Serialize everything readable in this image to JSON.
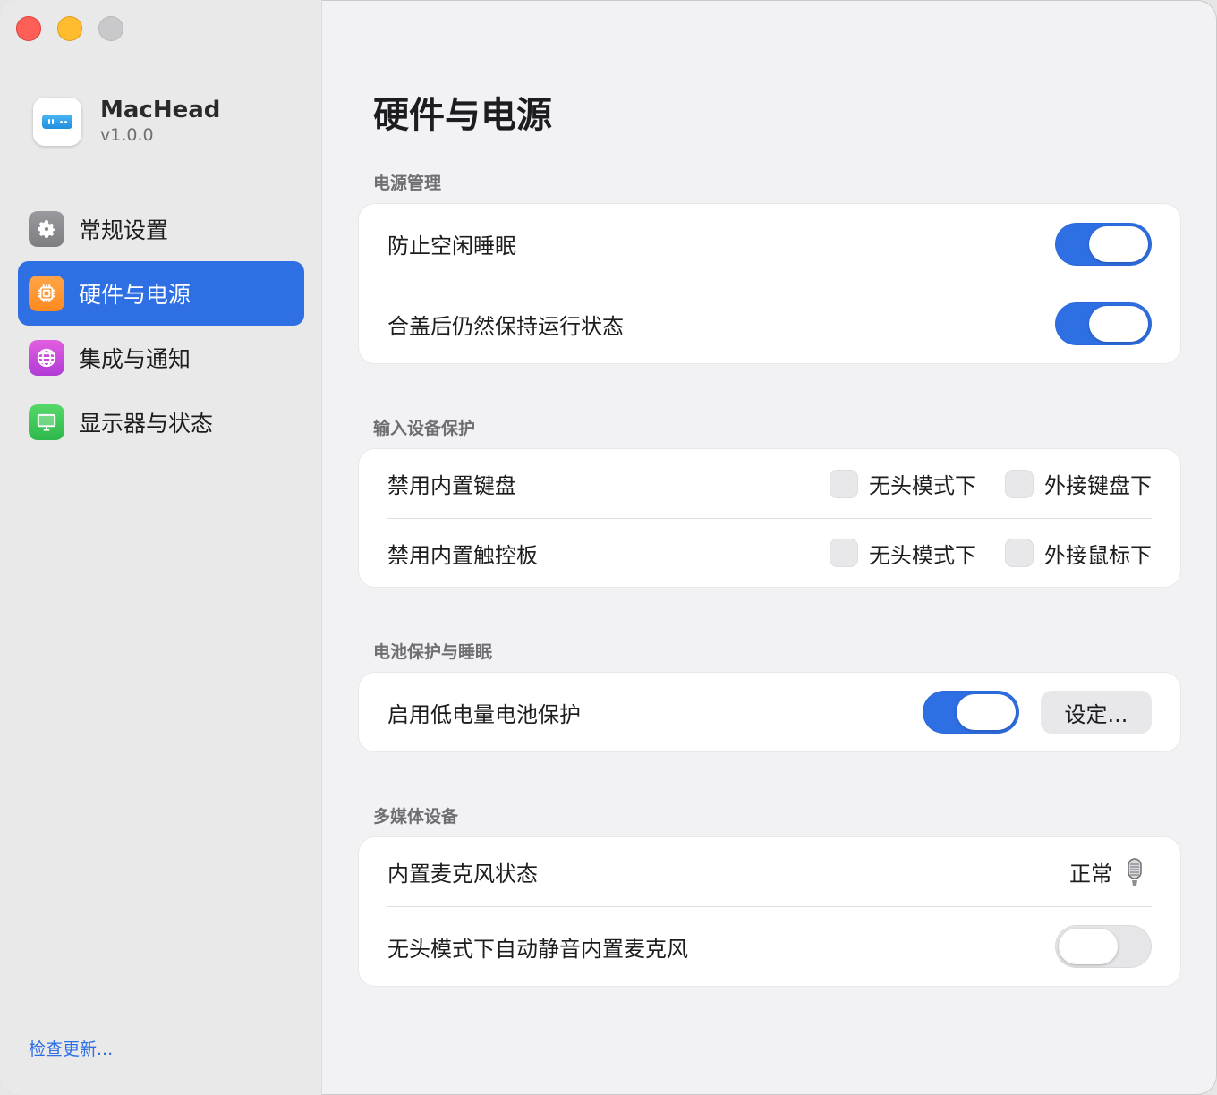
{
  "app": {
    "name": "MacHead",
    "version": "v1.0.0"
  },
  "sidebar": {
    "items": [
      {
        "label": "常规设置",
        "icon": "gear-icon"
      },
      {
        "label": "硬件与电源",
        "icon": "chip-icon"
      },
      {
        "label": "集成与通知",
        "icon": "globe-icon"
      },
      {
        "label": "显示器与状态",
        "icon": "monitor-icon"
      }
    ],
    "active_index": 1,
    "check_update": "检查更新..."
  },
  "page": {
    "title": "硬件与电源"
  },
  "sections": {
    "power": {
      "title": "电源管理",
      "rows": [
        {
          "label": "防止空闲睡眠",
          "enabled": true
        },
        {
          "label": "合盖后仍然保持运行状态",
          "enabled": true
        }
      ]
    },
    "input": {
      "title": "输入设备保护",
      "rows": [
        {
          "label": "禁用内置键盘",
          "option1": "无头模式下",
          "option2": "外接键盘下",
          "option1_checked": false,
          "option2_checked": false
        },
        {
          "label": "禁用内置触控板",
          "option1": "无头模式下",
          "option2": "外接鼠标下",
          "option1_checked": false,
          "option2_checked": false
        }
      ]
    },
    "battery": {
      "title": "电池保护与睡眠",
      "rows": [
        {
          "label": "启用低电量电池保护",
          "enabled": true,
          "button": "设定..."
        }
      ]
    },
    "media": {
      "title": "多媒体设备",
      "rows": [
        {
          "label": "内置麦克风状态",
          "status": "正常",
          "icon": "microphone-icon"
        },
        {
          "label": "无头模式下自动静音内置麦克风",
          "enabled": false
        }
      ]
    }
  },
  "colors": {
    "accent": "#2f6fe4",
    "sidebar_bg": "#e9e9ea",
    "main_bg": "#f2f2f4",
    "card_bg": "#ffffff"
  }
}
